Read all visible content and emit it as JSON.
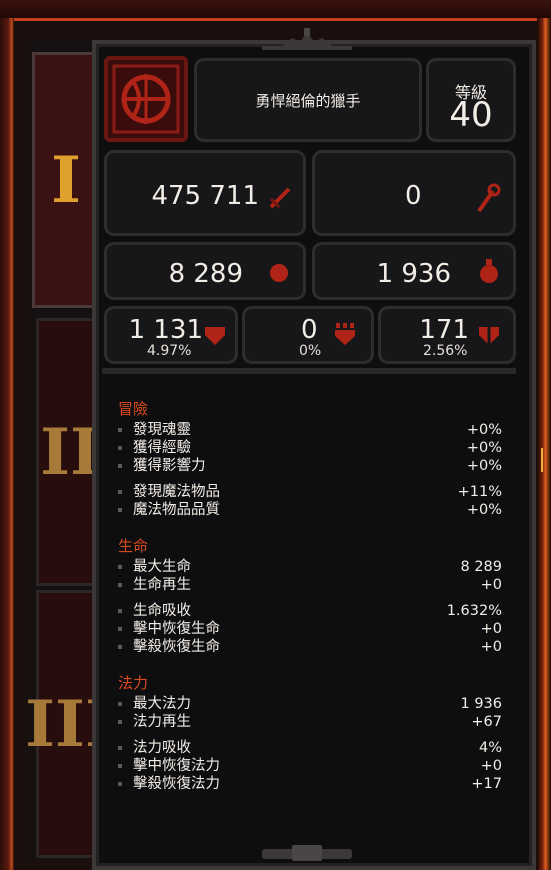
{
  "tabs": [
    "I",
    "II",
    "III"
  ],
  "character": {
    "title": "勇悍絕倫的獵手",
    "level_label": "等級",
    "level_value": "40",
    "class_icon": "crossbow-emblem-icon"
  },
  "stats_top": {
    "damage": "475 711",
    "damage_icon": "sword-icon",
    "secondary": "0",
    "secondary_icon": "staff-icon",
    "life": "8 289",
    "life_icon": "life-orb-icon",
    "mana": "1 936",
    "mana_icon": "mana-flask-icon"
  },
  "defense": [
    {
      "value": "1 131",
      "percent": "4.97%",
      "icon": "shield-icon"
    },
    {
      "value": "0",
      "percent": "0%",
      "icon": "crown-shield-icon"
    },
    {
      "value": "171",
      "percent": "2.56%",
      "icon": "cross-shield-icon"
    }
  ],
  "sections": {
    "adventure": {
      "title": "冒險",
      "rows": [
        {
          "label": "發現魂靈",
          "value": "+0%"
        },
        {
          "label": "獲得經驗",
          "value": "+0%"
        },
        {
          "label": "獲得影響力",
          "value": "+0%"
        },
        {
          "label": "發現魔法物品",
          "value": "+11%"
        },
        {
          "label": "魔法物品品質",
          "value": "+0%"
        }
      ]
    },
    "life": {
      "title": "生命",
      "rows": [
        {
          "label": "最大生命",
          "value": "8 289"
        },
        {
          "label": "生命再生",
          "value": "+0"
        },
        {
          "label": "生命吸收",
          "value": "1.632%"
        },
        {
          "label": "擊中恢復生命",
          "value": "+0"
        },
        {
          "label": "擊殺恢復生命",
          "value": "+0"
        }
      ]
    },
    "mana": {
      "title": "法力",
      "rows": [
        {
          "label": "最大法力",
          "value": "1 936"
        },
        {
          "label": "法力再生",
          "value": "+67"
        },
        {
          "label": "法力吸收",
          "value": "4%"
        },
        {
          "label": "擊中恢復法力",
          "value": "+0"
        },
        {
          "label": "擊殺恢復法力",
          "value": "+17"
        }
      ]
    }
  },
  "colors": {
    "accent_red": "#d94a1e",
    "gold_numeral": "#e0a02c",
    "frame_orange": "#c2401a"
  }
}
